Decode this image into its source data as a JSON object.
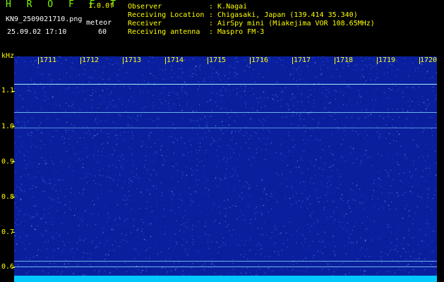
{
  "header": {
    "app_title": "H R O F F T",
    "version": "1.0.0f",
    "filename": "KN9_2509021710.png",
    "meteor_label": "meteor",
    "datetime": "25.09.02 17:10",
    "meteor_count": "60",
    "info_rows": [
      {
        "label": "Observer",
        "value": ": K.Nagai"
      },
      {
        "label": "Receiving Location",
        "value": ": Chigasaki, Japan (139.414 35.340)"
      },
      {
        "label": "Receiver",
        "value": ": AirSpy mini (Miakejima VOR 108.65MHz)"
      },
      {
        "label": "Receiving antenna",
        "value": ": Maspro FM-3"
      }
    ]
  },
  "spectrogram": {
    "y_unit": "kHz",
    "y_ticks": [
      "1.1",
      "1.0",
      "0.9",
      "0.8",
      "0.7",
      "0.6"
    ],
    "x_ticks": [
      "1711",
      "1712",
      "1713",
      "1714",
      "1715",
      "1716",
      "1717",
      "1718",
      "1719",
      "1720"
    ],
    "colors": {
      "background": "#0a1f9e",
      "carrier": "#9ff0ff",
      "axis": "#ffff00",
      "bar": "#00c8ff"
    }
  }
}
